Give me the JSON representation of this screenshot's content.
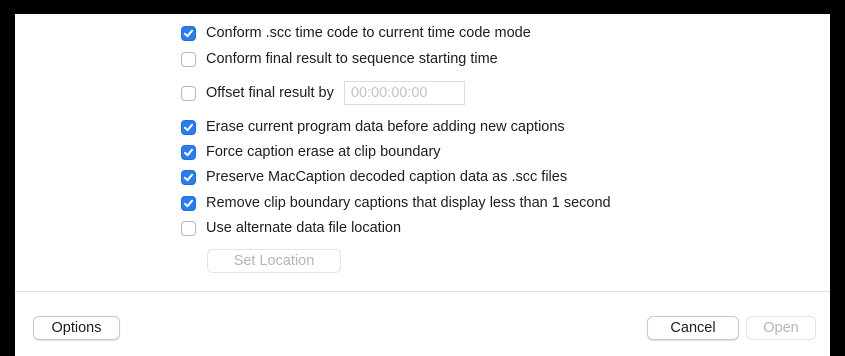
{
  "options": [
    {
      "label": "Conform .scc time code to current time code mode",
      "checked": true
    },
    {
      "label": "Conform final result to sequence starting time",
      "checked": false
    },
    {
      "label": "Offset final result by",
      "checked": false
    },
    {
      "label": "Erase current program data before adding new captions",
      "checked": true
    },
    {
      "label": "Force caption erase at clip boundary",
      "checked": true
    },
    {
      "label": "Preserve MacCaption decoded caption data as .scc files",
      "checked": true
    },
    {
      "label": "Remove clip boundary captions that display less than 1 second",
      "checked": true
    },
    {
      "label": "Use alternate data file location",
      "checked": false
    }
  ],
  "offset": {
    "placeholder": "00:00:00:00",
    "value": ""
  },
  "set_location_label": "Set Location",
  "footer": {
    "options_label": "Options",
    "cancel_label": "Cancel",
    "open_label": "Open"
  },
  "colors": {
    "accent": "#2a7dea",
    "background": "#ffffff",
    "frame": "#000000",
    "disabled_text": "#b5b5b5"
  },
  "icons": {
    "checked": "checkmark-icon",
    "unchecked": "empty-checkbox"
  }
}
